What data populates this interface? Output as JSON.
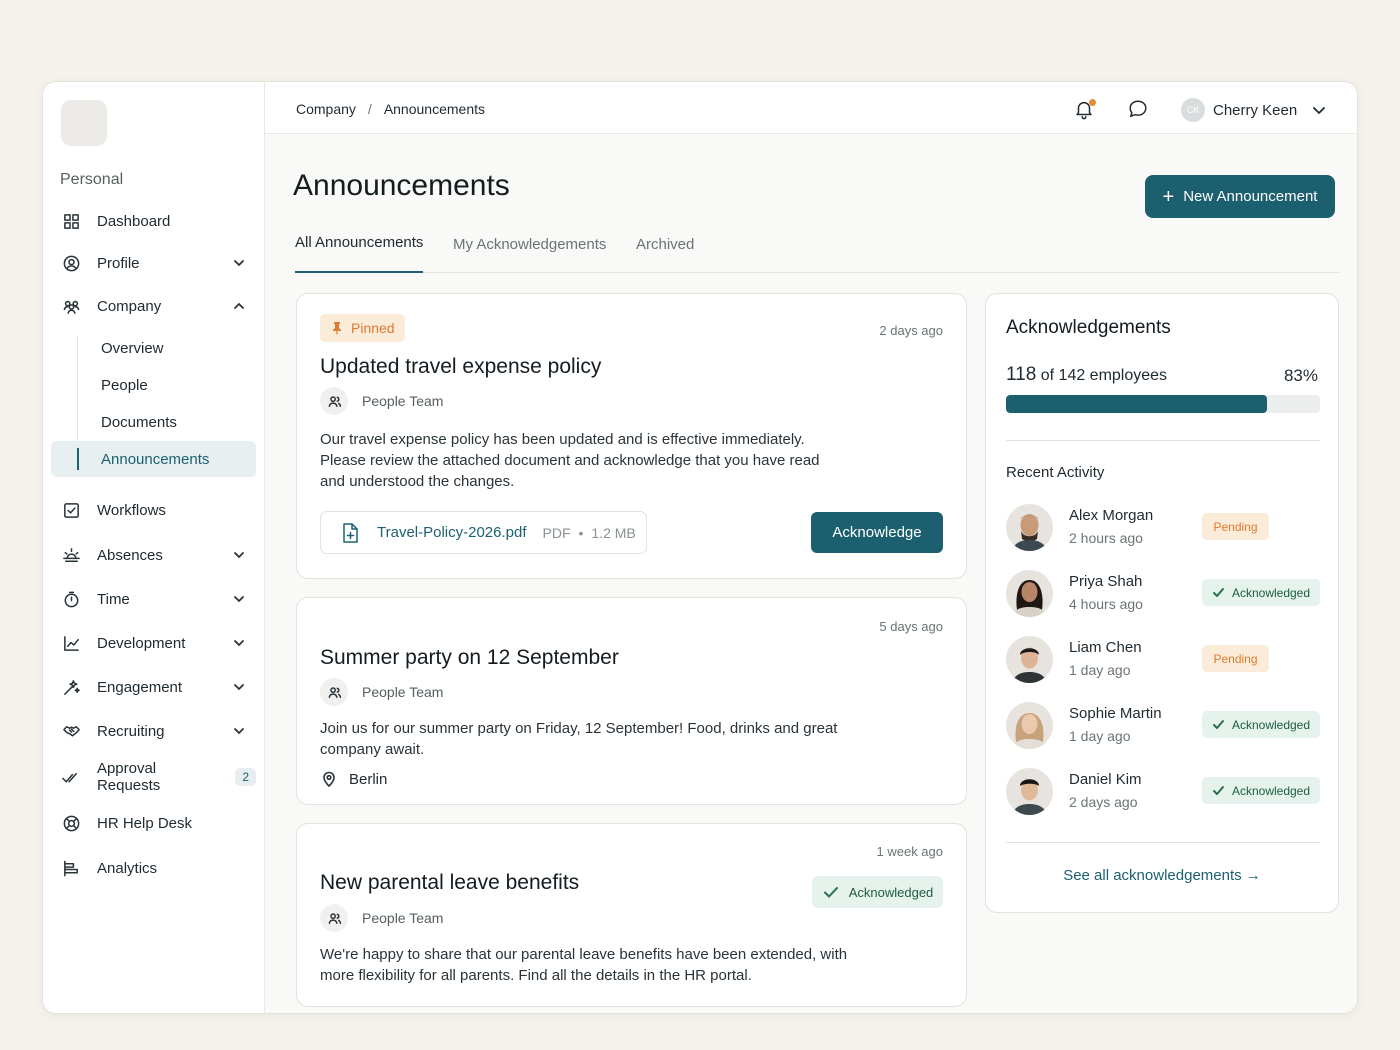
{
  "colors": {
    "accent": "#1c5f6e",
    "pinned": "#e07b2f",
    "acknowledged": "#1e5c44",
    "background": "#f5f2ec"
  },
  "sidebar": {
    "section_label": "Personal",
    "items": [
      {
        "label": "Dashboard",
        "icon": "grid-icon"
      },
      {
        "label": "Profile",
        "icon": "user-circle-icon"
      },
      {
        "label": "Company",
        "icon": "group-icon"
      },
      {
        "label": "Workflows",
        "icon": "checkbox-icon"
      },
      {
        "label": "Absences",
        "icon": "sunrise-icon"
      },
      {
        "label": "Time",
        "icon": "stopwatch-icon"
      },
      {
        "label": "Development",
        "icon": "chart-line-icon"
      },
      {
        "label": "Engagement",
        "icon": "sparkle-icon"
      },
      {
        "label": "Recruiting",
        "icon": "handshake-icon"
      },
      {
        "label": "Approval Requests",
        "icon": "double-check-icon",
        "badge": "2"
      },
      {
        "label": "HR Help Desk",
        "icon": "lifebuoy-icon"
      },
      {
        "label": "Analytics",
        "icon": "bar-chart-icon"
      }
    ],
    "company_sub": [
      "Overview",
      "People",
      "Documents",
      "Announcements"
    ]
  },
  "topbar": {
    "breadcrumb": [
      "Company",
      "/",
      "Announcements"
    ],
    "user": {
      "name": "Cherry Keen",
      "initials": "CK"
    }
  },
  "main": {
    "title": "Announcements",
    "new_button": "New Announcement",
    "tabs": [
      "All Announcements",
      "My Acknowledgements",
      "Archived"
    ]
  },
  "announcements": [
    {
      "badge": "Pinned",
      "time": "2 days ago",
      "title": "Updated travel expense policy",
      "author": "People Team",
      "body": "Our travel expense policy has been updated and is effective immediately. Please review the attached document and acknowledge that you have read and understood the changes.",
      "attachment": {
        "name": "Travel-Policy-2026.pdf",
        "type": "PDF",
        "dot": "•",
        "size": "1.2 MB"
      },
      "action": "Acknowledge"
    },
    {
      "time": "5 days ago",
      "title": "Summer party on 12 September",
      "author": "People Team",
      "body": "Join us for our summer party on Friday, 12 September! Food, drinks and great company await.",
      "location": "Berlin"
    },
    {
      "time": "1 week ago",
      "title": "New parental leave benefits",
      "author": "People Team",
      "status": "Acknowledged",
      "body": "We're happy to share that our parental leave benefits have been extended, with more flexibility for all parents. Find all the details in the HR portal."
    }
  ],
  "acknowledgements": {
    "title": "Acknowledgements",
    "count": "118",
    "of_text": "of 142 employees",
    "percent": "83%",
    "progress_fraction": 0.83,
    "recent_title": "Recent Activity",
    "activity": [
      {
        "name": "Alex Morgan",
        "time": "2 hours ago",
        "status": "Pending"
      },
      {
        "name": "Priya Shah",
        "time": "4 hours ago",
        "status": "Acknowledged"
      },
      {
        "name": "Liam Chen",
        "time": "1 day ago",
        "status": "Pending"
      },
      {
        "name": "Sophie Martin",
        "time": "1 day ago",
        "status": "Acknowledged"
      },
      {
        "name": "Daniel Kim",
        "time": "2 days ago",
        "status": "Acknowledged"
      }
    ],
    "see_all": "See all acknowledgements →"
  }
}
